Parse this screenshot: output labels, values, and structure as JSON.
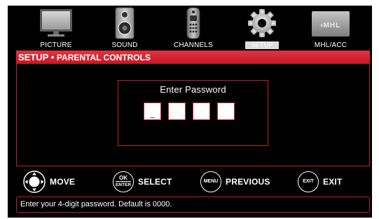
{
  "menu": {
    "items": [
      {
        "label": "PICTURE",
        "icon": "tv-icon"
      },
      {
        "label": "SOUND",
        "icon": "speaker-icon"
      },
      {
        "label": "CHANNELS",
        "icon": "remote-icon"
      },
      {
        "label": "SETUP",
        "icon": "gear-icon",
        "active": true
      },
      {
        "label": "MHL/ACC",
        "icon": "mhl-logo-icon",
        "logo_text": "MHL"
      }
    ]
  },
  "panel": {
    "title_main": "SETUP",
    "title_separator": "•",
    "title_sub": "PARENTAL CONTROLS"
  },
  "password": {
    "title": "Enter Password",
    "digits": [
      "_",
      "",
      "",
      ""
    ]
  },
  "hints": {
    "move_label": "MOVE",
    "select_key_top": "OK",
    "select_key_bottom": "ENTER",
    "select_label": "SELECT",
    "menu_key": "MENU",
    "previous_label": "PREVIOUS",
    "exit_key": "EXIT",
    "exit_label": "EXIT"
  },
  "status": {
    "text": "Enter your 4-digit password. Default is 0000."
  },
  "colors": {
    "accent_red": "#d0202d",
    "background": "#000000",
    "text": "#ffffff"
  }
}
